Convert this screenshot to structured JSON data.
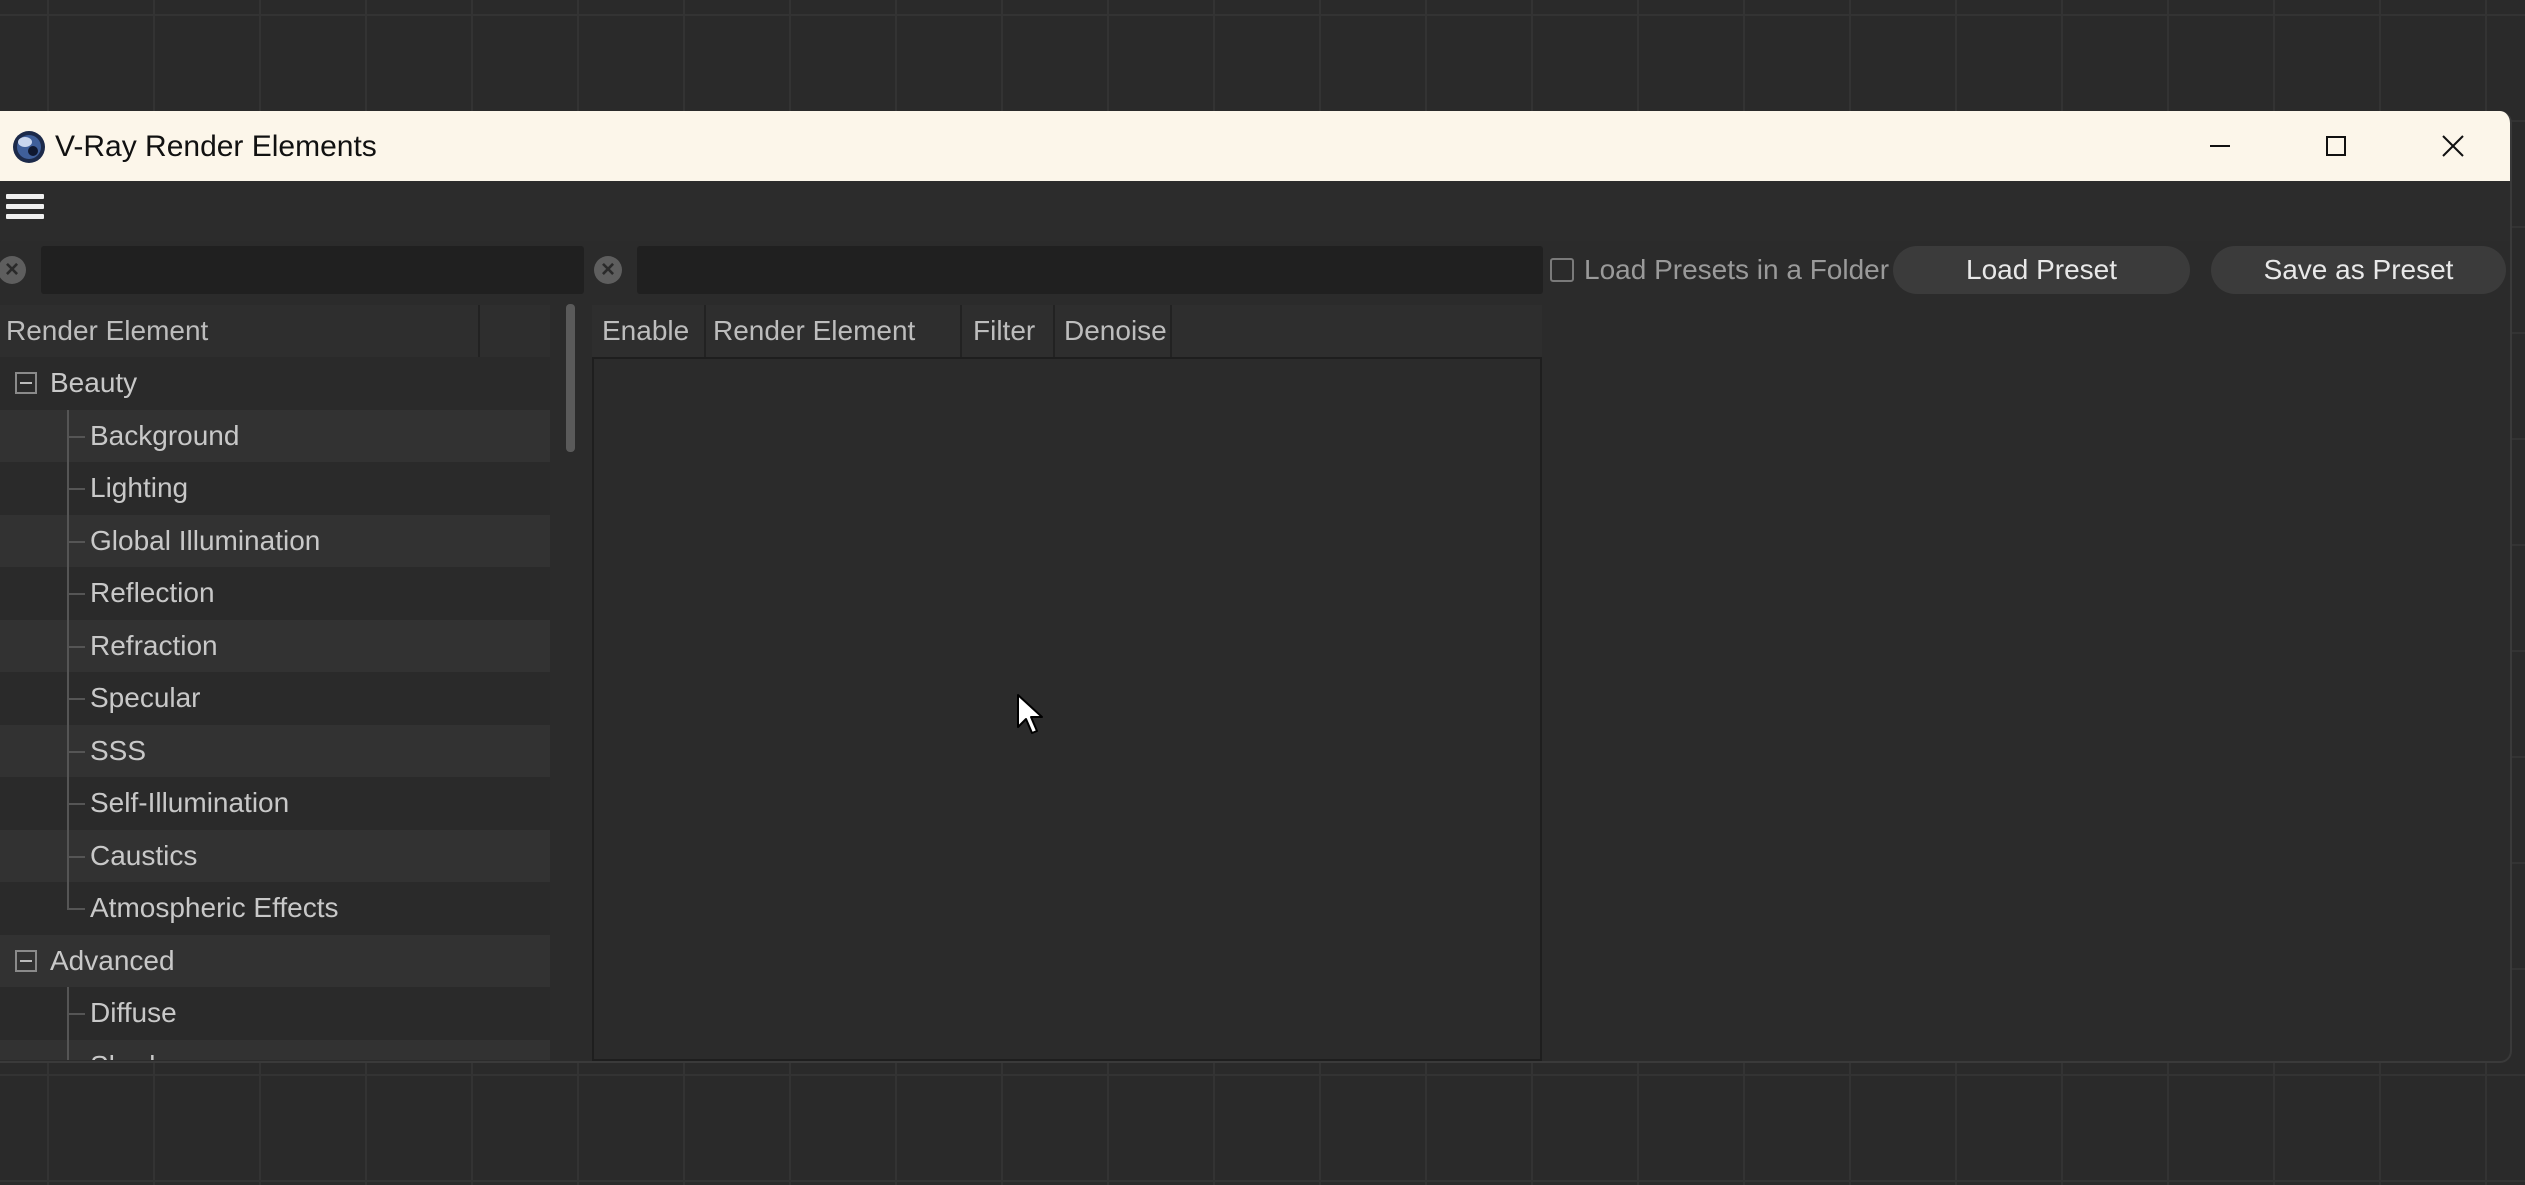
{
  "window": {
    "title": "V-Ray Render Elements",
    "icon": "cinema4d-app-icon"
  },
  "window_controls": [
    "minimize-icon",
    "maximize-icon",
    "close-icon"
  ],
  "menubar": {
    "icon": "hamburger-menu-icon"
  },
  "filters": {
    "left_search": {
      "value": "",
      "placeholder": ""
    },
    "right_search": {
      "value": "",
      "placeholder": ""
    }
  },
  "toolbar": {
    "load_presets_folder_label": "Load Presets in a Folder",
    "load_presets_folder_checked": false,
    "load_preset_label": "Load Preset",
    "save_preset_label": "Save as Preset"
  },
  "tree": {
    "header": "Render Element",
    "groups": [
      {
        "label": "Beauty",
        "expanded": true,
        "items": [
          "Background",
          "Lighting",
          "Global Illumination",
          "Reflection",
          "Refraction",
          "Specular",
          "SSS",
          "Self-Illumination",
          "Caustics",
          "Atmospheric Effects"
        ]
      },
      {
        "label": "Advanced",
        "expanded": true,
        "items": [
          "Diffuse",
          "Shadow"
        ]
      }
    ]
  },
  "table": {
    "columns": [
      "Enable",
      "Render Element",
      "Filter",
      "Denoise"
    ],
    "rows": []
  }
}
